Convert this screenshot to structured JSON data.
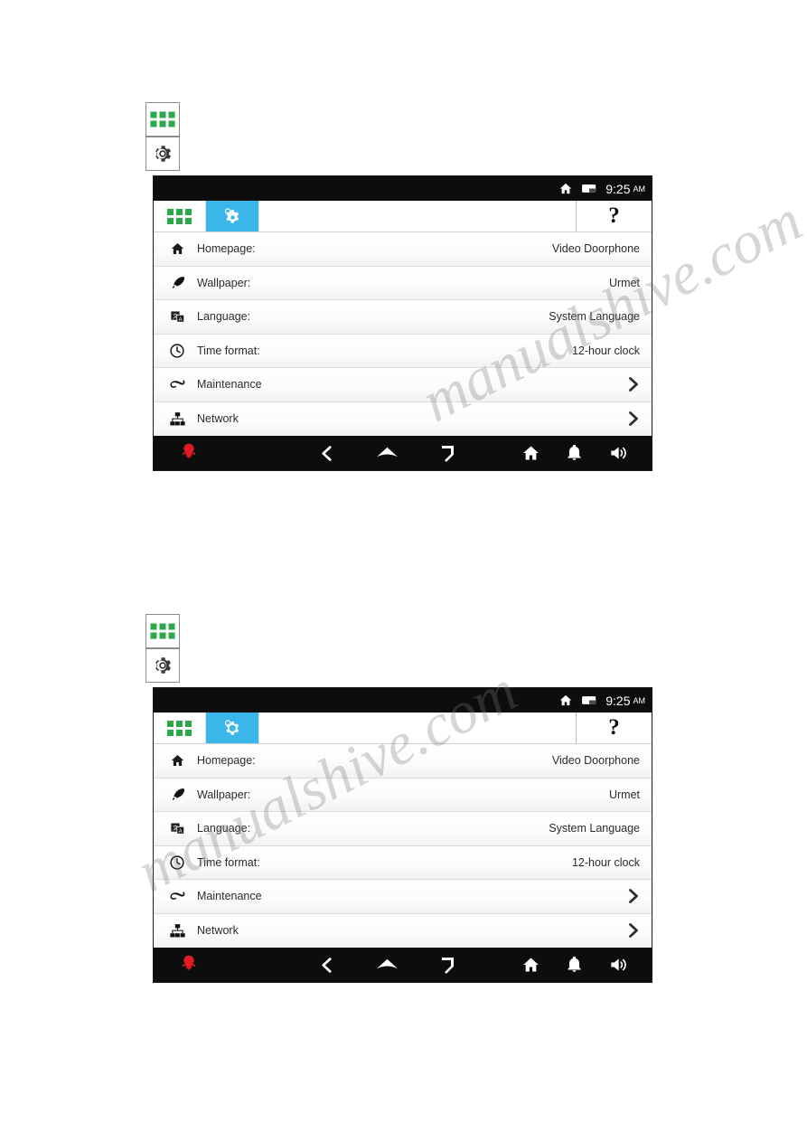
{
  "page": {
    "watermark_text_1": "manualshive.com",
    "watermark_text_2": "manualshive.com"
  },
  "standalone_icons": [
    {
      "name": "apps-grid-icon",
      "label": "apps"
    },
    {
      "name": "settings-gear-icon",
      "label": "settings"
    }
  ],
  "device": {
    "status_bar": {
      "home_icon": "home-icon",
      "sdcard_icon": "sdcard-icon",
      "time": "9:25",
      "ampm": "AM"
    },
    "tabs": [
      {
        "id": "apps",
        "icon": "apps-grid-icon",
        "label": ""
      },
      {
        "id": "settings",
        "icon": "gear-icon",
        "label": ""
      }
    ],
    "help_label": "?",
    "rows": [
      {
        "icon": "home-icon",
        "label": "Homepage:",
        "value": "Video Doorphone",
        "type": "value"
      },
      {
        "icon": "wallpaper-icon",
        "label": "Wallpaper:",
        "value": "Urmet",
        "type": "value"
      },
      {
        "icon": "language-icon",
        "label": "Language:",
        "value": "System Language",
        "type": "value"
      },
      {
        "icon": "clock-icon",
        "label": "Time format:",
        "value": "12-hour clock",
        "type": "value"
      },
      {
        "icon": "maintenance-icon",
        "label": "Maintenance",
        "value": "",
        "type": "chevron"
      },
      {
        "icon": "network-icon",
        "label": "Network",
        "value": "",
        "type": "chevron"
      }
    ],
    "navbar": {
      "logo": "urmet-logo-icon",
      "items": [
        {
          "name": "back-icon"
        },
        {
          "name": "home-nav-icon"
        },
        {
          "name": "recents-icon"
        },
        {
          "name": "house-icon"
        },
        {
          "name": "bell-icon"
        },
        {
          "name": "volume-icon"
        }
      ]
    }
  },
  "colors": {
    "accent": "#3ab7e8",
    "grid_green": "#2aa84a",
    "bar_black": "#0d0d0d",
    "logo_red": "#e01b24"
  }
}
